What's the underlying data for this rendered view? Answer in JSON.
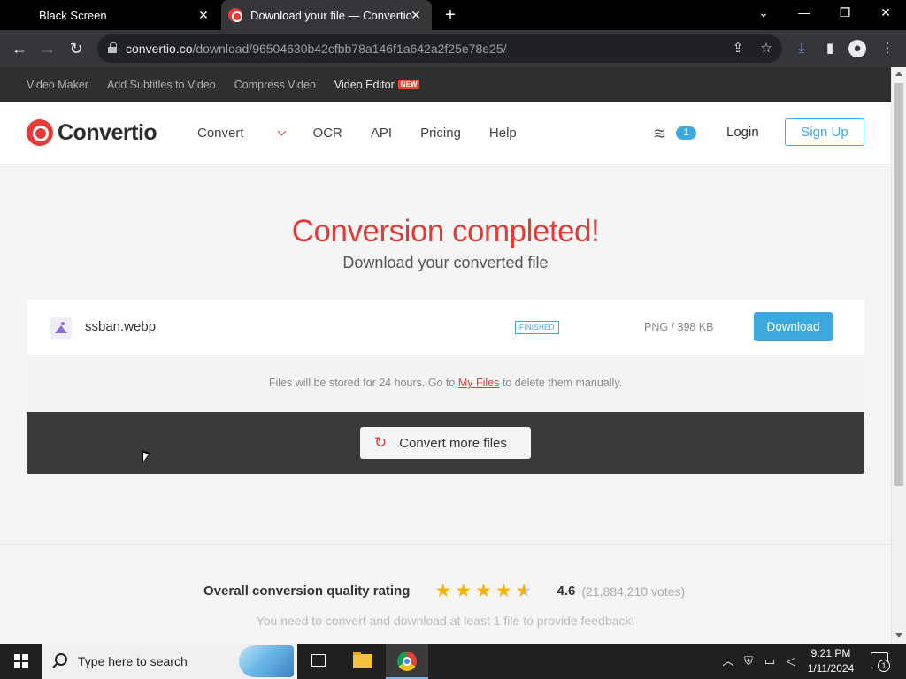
{
  "browser": {
    "tabs": [
      {
        "title": "Black Screen",
        "active": false
      },
      {
        "title": "Download your file — Convertio",
        "active": true
      }
    ],
    "new_tab_label": "+",
    "window_controls": {
      "list_tabs": "⌄",
      "minimize": "—",
      "restore": "❐",
      "close": "✕"
    },
    "url_host": "convertio.co",
    "url_path": "/download/96504630b42cfbb78a146f1a642a2f25e78e25/"
  },
  "subnav": {
    "items": [
      "Video Maker",
      "Add Subtitles to Video",
      "Compress Video",
      "Video Editor"
    ],
    "new_badge": "NEW"
  },
  "header": {
    "logo_text": "Convertio",
    "nav": [
      "Convert",
      "OCR",
      "API",
      "Pricing",
      "Help"
    ],
    "queue_count": "1",
    "login": "Login",
    "signup": "Sign Up"
  },
  "hero": {
    "title": "Conversion completed!",
    "subtitle": "Download your converted file"
  },
  "file": {
    "name": "ssban.webp",
    "status": "FINISHED",
    "meta": "PNG / 398 KB",
    "download_label": "Download"
  },
  "storage_note": {
    "before": "Files will be stored for 24 hours. Go to ",
    "link": "My Files",
    "after": " to delete them manually."
  },
  "convert_more": {
    "label": "Convert more files"
  },
  "rating": {
    "label": "Overall conversion quality rating",
    "score": "4.6",
    "votes": "(21,884,210 votes)",
    "stars": 4.6,
    "feedback": "You need to convert and download at least 1 file to provide feedback!"
  },
  "taskbar": {
    "search_placeholder": "Type here to search",
    "time": "9:21 PM",
    "date": "1/11/2024",
    "notification_count": "1"
  },
  "colors": {
    "accent_red": "#e23c39",
    "accent_blue": "#3ba9e0",
    "star": "#f5b400"
  }
}
